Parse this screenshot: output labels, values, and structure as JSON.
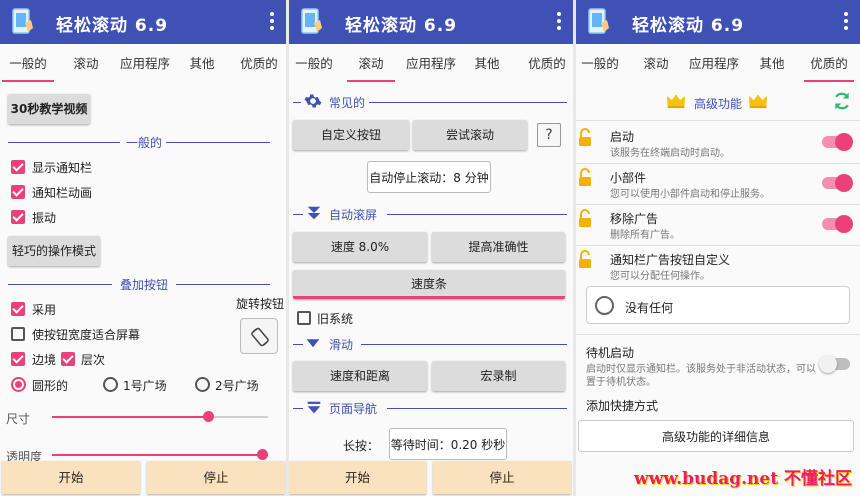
{
  "app": {
    "title": "轻松滚动 6.9"
  },
  "tabs": [
    "一般的",
    "滚动",
    "应用程序",
    "其他",
    "优质的"
  ],
  "general": {
    "tutorial_button": "30秒教学视频",
    "section_general": "一般的",
    "checkboxes": [
      {
        "label": "显示通知栏",
        "checked": true
      },
      {
        "label": "通知栏动画",
        "checked": true
      },
      {
        "label": "振动",
        "checked": true
      }
    ],
    "skillful_mode_button": "轻巧的操作模式",
    "section_overlay": "叠加按钮",
    "enable_label": "采用",
    "rotate_label": "旋转按钮",
    "fit_width_label": "使按钮宽度适合屏幕",
    "border_label": "边境",
    "layer_label": "层次",
    "shapes": [
      {
        "label": "圆形的",
        "selected": true
      },
      {
        "label": "1号广场",
        "selected": false
      },
      {
        "label": "2号广场",
        "selected": false
      }
    ],
    "size_label": "尺寸",
    "size_value": 0.72,
    "opacity_label": "透明度",
    "opacity_value": 1.0
  },
  "scroll": {
    "section_common": "常见的",
    "custom_button": "自定义按钮",
    "try_scroll": "尝试滚动",
    "help": "?",
    "auto_stop": "自动停止滚动：8 分钟",
    "section_auto": "自动滚屏",
    "speed": "速度 8.0%",
    "accuracy": "提高准确性",
    "speed_bar": "速度条",
    "legacy_label": "旧系统",
    "section_swipe": "滑动",
    "speed_distance": "速度和距离",
    "macro": "宏录制",
    "section_page": "页面导航",
    "long_press_label": "长按：",
    "wait_time": "等待时间：0.20 秒秒"
  },
  "bottom": {
    "start": "开始",
    "stop": "停止"
  },
  "premium": {
    "header": "高级功能",
    "features": [
      {
        "title": "启动",
        "desc": "该服务在终端启动时启动。",
        "toggle": true
      },
      {
        "title": "小部件",
        "desc": "您可以使用小部件启动和停止服务。",
        "toggle": true
      },
      {
        "title": "移除广告",
        "desc": "删除所有广告。",
        "toggle": true
      },
      {
        "title": "通知栏广告按钮自定义",
        "desc": "您可以分配任何操作。",
        "toggle": null
      }
    ],
    "none_label": "没有任何",
    "standby_title": "待机启动",
    "standby_desc1": "启动时仅显示通知栏。该服务处于非活动状态，可以",
    "standby_desc2": "置于待机状态。",
    "standby_toggle": false,
    "add_shortcut": "添加快捷方式",
    "details_button": "高级功能的详细信息"
  },
  "watermark": "www.budag.net 不懂社区",
  "colors": {
    "primary": "#3f51b5",
    "accent": "#ec407a",
    "bottom_button": "#fbe2bf"
  }
}
